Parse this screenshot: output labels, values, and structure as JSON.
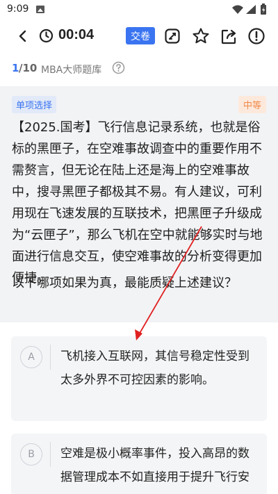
{
  "status_bar": {
    "time": "9:09",
    "icons": [
      "image-icon",
      "wifi-icon",
      "signal-icon",
      "battery-icon"
    ]
  },
  "toolbar": {
    "timer": "00:04",
    "submit_label": "交卷",
    "icons": [
      "back-icon",
      "timer-icon",
      "edit-note-icon",
      "star-icon",
      "share-icon",
      "report-icon"
    ]
  },
  "progress": {
    "current": "1",
    "total": "/10",
    "bank_name": "MBA大师题库"
  },
  "question": {
    "type_tag": "单项选择",
    "difficulty": "中等",
    "stem": "【2025.国考】飞行信息记录系统，也就是俗标的黑匣子，在空难事故调查中的重要作用不需赘言，但无论在陆上还是海上的空难事故中，搜寻黑匣子都极其不易。有人建议，可利用现在飞速发展的互联技术，把黑匣子升级成为“云匣子”，那么飞机在空中就能够实时与地面进行信息交互，使空难事故的分析变得更加便捷。",
    "ask": "以下哪项如果为真，最能质疑上述建议？"
  },
  "options": [
    {
      "letter": "A",
      "text": "飞机接入互联网，其信号稳定性受到太多外界不可控因素的影响。"
    },
    {
      "letter": "B",
      "text": "空难是极小概率事件，投入高昂的数据管理成本不如直接用于提升飞行安全。"
    }
  ],
  "colors": {
    "accent": "#3a74f0",
    "difficulty": "#f08a4b",
    "annotation_arrow": "#e02020"
  }
}
